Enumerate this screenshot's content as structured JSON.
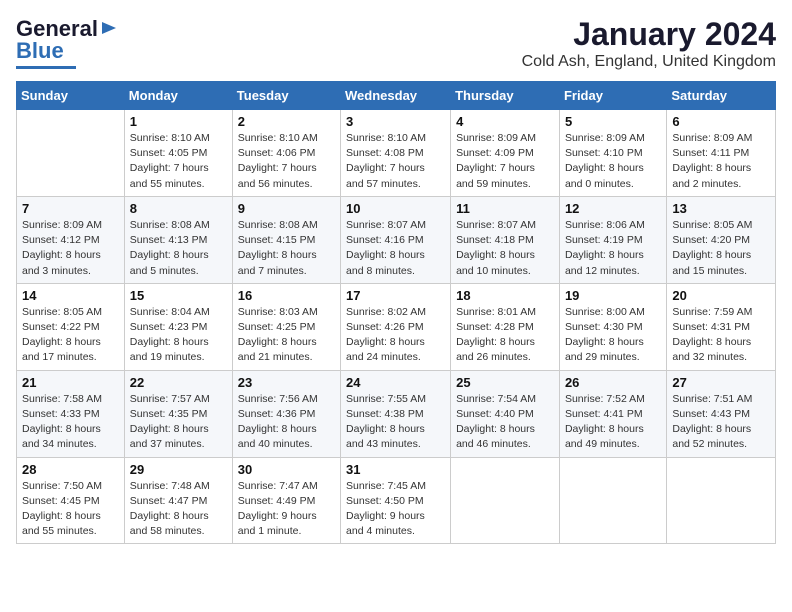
{
  "logo": {
    "line1": "General",
    "line2": "Blue"
  },
  "title": "January 2024",
  "subtitle": "Cold Ash, England, United Kingdom",
  "days_of_week": [
    "Sunday",
    "Monday",
    "Tuesday",
    "Wednesday",
    "Thursday",
    "Friday",
    "Saturday"
  ],
  "weeks": [
    [
      {
        "day": "",
        "sunrise": "",
        "sunset": "",
        "daylight": ""
      },
      {
        "day": "1",
        "sunrise": "Sunrise: 8:10 AM",
        "sunset": "Sunset: 4:05 PM",
        "daylight": "Daylight: 7 hours and 55 minutes."
      },
      {
        "day": "2",
        "sunrise": "Sunrise: 8:10 AM",
        "sunset": "Sunset: 4:06 PM",
        "daylight": "Daylight: 7 hours and 56 minutes."
      },
      {
        "day": "3",
        "sunrise": "Sunrise: 8:10 AM",
        "sunset": "Sunset: 4:08 PM",
        "daylight": "Daylight: 7 hours and 57 minutes."
      },
      {
        "day": "4",
        "sunrise": "Sunrise: 8:09 AM",
        "sunset": "Sunset: 4:09 PM",
        "daylight": "Daylight: 7 hours and 59 minutes."
      },
      {
        "day": "5",
        "sunrise": "Sunrise: 8:09 AM",
        "sunset": "Sunset: 4:10 PM",
        "daylight": "Daylight: 8 hours and 0 minutes."
      },
      {
        "day": "6",
        "sunrise": "Sunrise: 8:09 AM",
        "sunset": "Sunset: 4:11 PM",
        "daylight": "Daylight: 8 hours and 2 minutes."
      }
    ],
    [
      {
        "day": "7",
        "sunrise": "Sunrise: 8:09 AM",
        "sunset": "Sunset: 4:12 PM",
        "daylight": "Daylight: 8 hours and 3 minutes."
      },
      {
        "day": "8",
        "sunrise": "Sunrise: 8:08 AM",
        "sunset": "Sunset: 4:13 PM",
        "daylight": "Daylight: 8 hours and 5 minutes."
      },
      {
        "day": "9",
        "sunrise": "Sunrise: 8:08 AM",
        "sunset": "Sunset: 4:15 PM",
        "daylight": "Daylight: 8 hours and 7 minutes."
      },
      {
        "day": "10",
        "sunrise": "Sunrise: 8:07 AM",
        "sunset": "Sunset: 4:16 PM",
        "daylight": "Daylight: 8 hours and 8 minutes."
      },
      {
        "day": "11",
        "sunrise": "Sunrise: 8:07 AM",
        "sunset": "Sunset: 4:18 PM",
        "daylight": "Daylight: 8 hours and 10 minutes."
      },
      {
        "day": "12",
        "sunrise": "Sunrise: 8:06 AM",
        "sunset": "Sunset: 4:19 PM",
        "daylight": "Daylight: 8 hours and 12 minutes."
      },
      {
        "day": "13",
        "sunrise": "Sunrise: 8:05 AM",
        "sunset": "Sunset: 4:20 PM",
        "daylight": "Daylight: 8 hours and 15 minutes."
      }
    ],
    [
      {
        "day": "14",
        "sunrise": "Sunrise: 8:05 AM",
        "sunset": "Sunset: 4:22 PM",
        "daylight": "Daylight: 8 hours and 17 minutes."
      },
      {
        "day": "15",
        "sunrise": "Sunrise: 8:04 AM",
        "sunset": "Sunset: 4:23 PM",
        "daylight": "Daylight: 8 hours and 19 minutes."
      },
      {
        "day": "16",
        "sunrise": "Sunrise: 8:03 AM",
        "sunset": "Sunset: 4:25 PM",
        "daylight": "Daylight: 8 hours and 21 minutes."
      },
      {
        "day": "17",
        "sunrise": "Sunrise: 8:02 AM",
        "sunset": "Sunset: 4:26 PM",
        "daylight": "Daylight: 8 hours and 24 minutes."
      },
      {
        "day": "18",
        "sunrise": "Sunrise: 8:01 AM",
        "sunset": "Sunset: 4:28 PM",
        "daylight": "Daylight: 8 hours and 26 minutes."
      },
      {
        "day": "19",
        "sunrise": "Sunrise: 8:00 AM",
        "sunset": "Sunset: 4:30 PM",
        "daylight": "Daylight: 8 hours and 29 minutes."
      },
      {
        "day": "20",
        "sunrise": "Sunrise: 7:59 AM",
        "sunset": "Sunset: 4:31 PM",
        "daylight": "Daylight: 8 hours and 32 minutes."
      }
    ],
    [
      {
        "day": "21",
        "sunrise": "Sunrise: 7:58 AM",
        "sunset": "Sunset: 4:33 PM",
        "daylight": "Daylight: 8 hours and 34 minutes."
      },
      {
        "day": "22",
        "sunrise": "Sunrise: 7:57 AM",
        "sunset": "Sunset: 4:35 PM",
        "daylight": "Daylight: 8 hours and 37 minutes."
      },
      {
        "day": "23",
        "sunrise": "Sunrise: 7:56 AM",
        "sunset": "Sunset: 4:36 PM",
        "daylight": "Daylight: 8 hours and 40 minutes."
      },
      {
        "day": "24",
        "sunrise": "Sunrise: 7:55 AM",
        "sunset": "Sunset: 4:38 PM",
        "daylight": "Daylight: 8 hours and 43 minutes."
      },
      {
        "day": "25",
        "sunrise": "Sunrise: 7:54 AM",
        "sunset": "Sunset: 4:40 PM",
        "daylight": "Daylight: 8 hours and 46 minutes."
      },
      {
        "day": "26",
        "sunrise": "Sunrise: 7:52 AM",
        "sunset": "Sunset: 4:41 PM",
        "daylight": "Daylight: 8 hours and 49 minutes."
      },
      {
        "day": "27",
        "sunrise": "Sunrise: 7:51 AM",
        "sunset": "Sunset: 4:43 PM",
        "daylight": "Daylight: 8 hours and 52 minutes."
      }
    ],
    [
      {
        "day": "28",
        "sunrise": "Sunrise: 7:50 AM",
        "sunset": "Sunset: 4:45 PM",
        "daylight": "Daylight: 8 hours and 55 minutes."
      },
      {
        "day": "29",
        "sunrise": "Sunrise: 7:48 AM",
        "sunset": "Sunset: 4:47 PM",
        "daylight": "Daylight: 8 hours and 58 minutes."
      },
      {
        "day": "30",
        "sunrise": "Sunrise: 7:47 AM",
        "sunset": "Sunset: 4:49 PM",
        "daylight": "Daylight: 9 hours and 1 minute."
      },
      {
        "day": "31",
        "sunrise": "Sunrise: 7:45 AM",
        "sunset": "Sunset: 4:50 PM",
        "daylight": "Daylight: 9 hours and 4 minutes."
      },
      {
        "day": "",
        "sunrise": "",
        "sunset": "",
        "daylight": ""
      },
      {
        "day": "",
        "sunrise": "",
        "sunset": "",
        "daylight": ""
      },
      {
        "day": "",
        "sunrise": "",
        "sunset": "",
        "daylight": ""
      }
    ]
  ]
}
